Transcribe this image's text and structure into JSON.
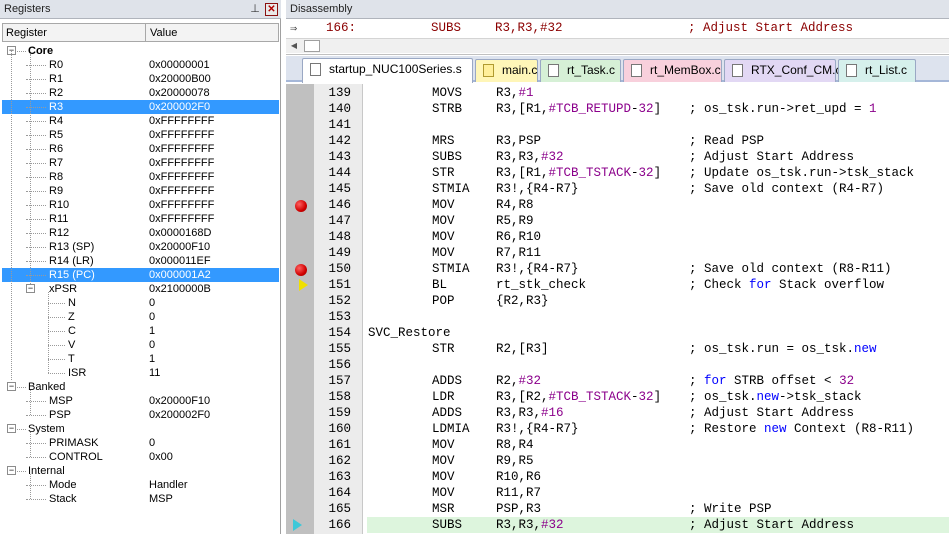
{
  "registers_panel": {
    "title": "Registers",
    "pin_icon": "pin-icon",
    "close_icon": "close-icon",
    "col_register": "Register",
    "col_value": "Value",
    "core_label": "Core",
    "core_regs": [
      {
        "name": "R0",
        "value": "0x00000001"
      },
      {
        "name": "R1",
        "value": "0x20000B00"
      },
      {
        "name": "R2",
        "value": "0x20000078"
      },
      {
        "name": "R3",
        "value": "0x200002F0"
      },
      {
        "name": "R4",
        "value": "0xFFFFFFFF"
      },
      {
        "name": "R5",
        "value": "0xFFFFFFFF"
      },
      {
        "name": "R6",
        "value": "0xFFFFFFFF"
      },
      {
        "name": "R7",
        "value": "0xFFFFFFFF"
      },
      {
        "name": "R8",
        "value": "0xFFFFFFFF"
      },
      {
        "name": "R9",
        "value": "0xFFFFFFFF"
      },
      {
        "name": "R10",
        "value": "0xFFFFFFFF"
      },
      {
        "name": "R11",
        "value": "0xFFFFFFFF"
      },
      {
        "name": "R12",
        "value": "0x0000168D"
      },
      {
        "name": "R13 (SP)",
        "value": "0x20000F10"
      },
      {
        "name": "R14 (LR)",
        "value": "0x000011EF"
      },
      {
        "name": "R15 (PC)",
        "value": "0x000001A2"
      }
    ],
    "xpsr": {
      "name": "xPSR",
      "value": "0x2100000B"
    },
    "xpsr_bits": [
      {
        "name": "N",
        "value": "0"
      },
      {
        "name": "Z",
        "value": "0"
      },
      {
        "name": "C",
        "value": "1"
      },
      {
        "name": "V",
        "value": "0"
      },
      {
        "name": "T",
        "value": "1"
      },
      {
        "name": "ISR",
        "value": "11"
      }
    ],
    "banked_label": "Banked",
    "banked": [
      {
        "name": "MSP",
        "value": "0x20000F10"
      },
      {
        "name": "PSP",
        "value": "0x200002F0"
      }
    ],
    "system_label": "System",
    "system": [
      {
        "name": "PRIMASK",
        "value": "0"
      },
      {
        "name": "CONTROL",
        "value": "0x00"
      }
    ],
    "internal_label": "Internal",
    "internal": [
      {
        "name": "Mode",
        "value": "Handler"
      },
      {
        "name": "Stack",
        "value": "MSP"
      }
    ],
    "selected_rows": [
      "R3",
      "R15 (PC)"
    ],
    "selection_color": "#3399ff"
  },
  "disassembly_panel": {
    "title": "Disassembly",
    "top_line": {
      "lineno": "166:",
      "op": "SUBS",
      "args": "R3,R3,#32",
      "comment": "; Adjust Start Address"
    }
  },
  "tabs": [
    {
      "label": "startup_NUC100Series.s",
      "color": "#eef2fa",
      "icon": "file-icon"
    },
    {
      "label": "main.c",
      "color": "#fff6b8",
      "icon": "file-icon"
    },
    {
      "label": "rt_Task.c",
      "color": "#d6f0d6",
      "icon": "file-icon"
    },
    {
      "label": "rt_MemBox.c",
      "color": "#f8d0dc",
      "icon": "file-icon"
    },
    {
      "label": "RTX_Conf_CM.c",
      "color": "#e2d8f4",
      "icon": "file-icon"
    },
    {
      "label": "rt_List.c",
      "color": "#d6f0ec",
      "icon": "file-icon"
    }
  ],
  "code_lines": [
    {
      "n": "139",
      "label": "",
      "op": "MOVS",
      "args": "R3,#1",
      "comment": ""
    },
    {
      "n": "140",
      "label": "",
      "op": "STRB",
      "args": "R3,[R1,#TCB_RETUPD-32]",
      "comment": "; os_tsk.run->ret_upd = 1"
    },
    {
      "n": "141",
      "label": "",
      "op": "",
      "args": "",
      "comment": ""
    },
    {
      "n": "142",
      "label": "",
      "op": "MRS",
      "args": "R3,PSP",
      "comment": "; Read PSP"
    },
    {
      "n": "143",
      "label": "",
      "op": "SUBS",
      "args": "R3,R3,#32",
      "comment": "; Adjust Start Address"
    },
    {
      "n": "144",
      "label": "",
      "op": "STR",
      "args": "R3,[R1,#TCB_TSTACK-32]",
      "comment": "; Update os_tsk.run->tsk_stack"
    },
    {
      "n": "145",
      "label": "",
      "op": "STMIA",
      "args": "R3!,{R4-R7}",
      "comment": "; Save old context (R4-R7)"
    },
    {
      "n": "146",
      "label": "",
      "op": "MOV",
      "args": "R4,R8",
      "comment": ""
    },
    {
      "n": "147",
      "label": "",
      "op": "MOV",
      "args": "R5,R9",
      "comment": ""
    },
    {
      "n": "148",
      "label": "",
      "op": "MOV",
      "args": "R6,R10",
      "comment": ""
    },
    {
      "n": "149",
      "label": "",
      "op": "MOV",
      "args": "R7,R11",
      "comment": ""
    },
    {
      "n": "150",
      "label": "",
      "op": "STMIA",
      "args": "R3!,{R4-R7}",
      "comment": "; Save old context (R8-R11)"
    },
    {
      "n": "151",
      "label": "",
      "op": "BL",
      "args": "rt_stk_check",
      "comment": "; Check for Stack overflow"
    },
    {
      "n": "152",
      "label": "",
      "op": "POP",
      "args": "{R2,R3}",
      "comment": ""
    },
    {
      "n": "153",
      "label": "",
      "op": "",
      "args": "",
      "comment": ""
    },
    {
      "n": "154",
      "label": "SVC_Restore",
      "op": "",
      "args": "",
      "comment": ""
    },
    {
      "n": "155",
      "label": "",
      "op": "STR",
      "args": "R2,[R3]",
      "comment": "; os_tsk.run = os_tsk.new"
    },
    {
      "n": "156",
      "label": "",
      "op": "",
      "args": "",
      "comment": ""
    },
    {
      "n": "157",
      "label": "",
      "op": "ADDS",
      "args": "R2,#32",
      "comment": "; for STRB offset < 32"
    },
    {
      "n": "158",
      "label": "",
      "op": "LDR",
      "args": "R3,[R2,#TCB_TSTACK-32]",
      "comment": "; os_tsk.new->tsk_stack"
    },
    {
      "n": "159",
      "label": "",
      "op": "ADDS",
      "args": "R3,R3,#16",
      "comment": "; Adjust Start Address"
    },
    {
      "n": "160",
      "label": "",
      "op": "LDMIA",
      "args": "R3!,{R4-R7}",
      "comment": "; Restore new Context (R8-R11)"
    },
    {
      "n": "161",
      "label": "",
      "op": "MOV",
      "args": "R8,R4",
      "comment": ""
    },
    {
      "n": "162",
      "label": "",
      "op": "MOV",
      "args": "R9,R5",
      "comment": ""
    },
    {
      "n": "163",
      "label": "",
      "op": "MOV",
      "args": "R10,R6",
      "comment": ""
    },
    {
      "n": "164",
      "label": "",
      "op": "MOV",
      "args": "R11,R7",
      "comment": ""
    },
    {
      "n": "165",
      "label": "",
      "op": "MSR",
      "args": "PSP,R3",
      "comment": "; Write PSP"
    },
    {
      "n": "166",
      "label": "",
      "op": "SUBS",
      "args": "R3,R3,#32",
      "comment": "; Adjust Start Address"
    }
  ],
  "breakpoints": [
    "146",
    "150"
  ],
  "current_pc_line": "151",
  "cursor_line": "166",
  "colors": {
    "keyword": "#0000ff",
    "number": "#8b008b",
    "breakpoint": "#d00000",
    "pc_marker": "#f0e000",
    "cursor_marker": "#3ec8d8",
    "current_line_bg": "#ddf5dd"
  }
}
